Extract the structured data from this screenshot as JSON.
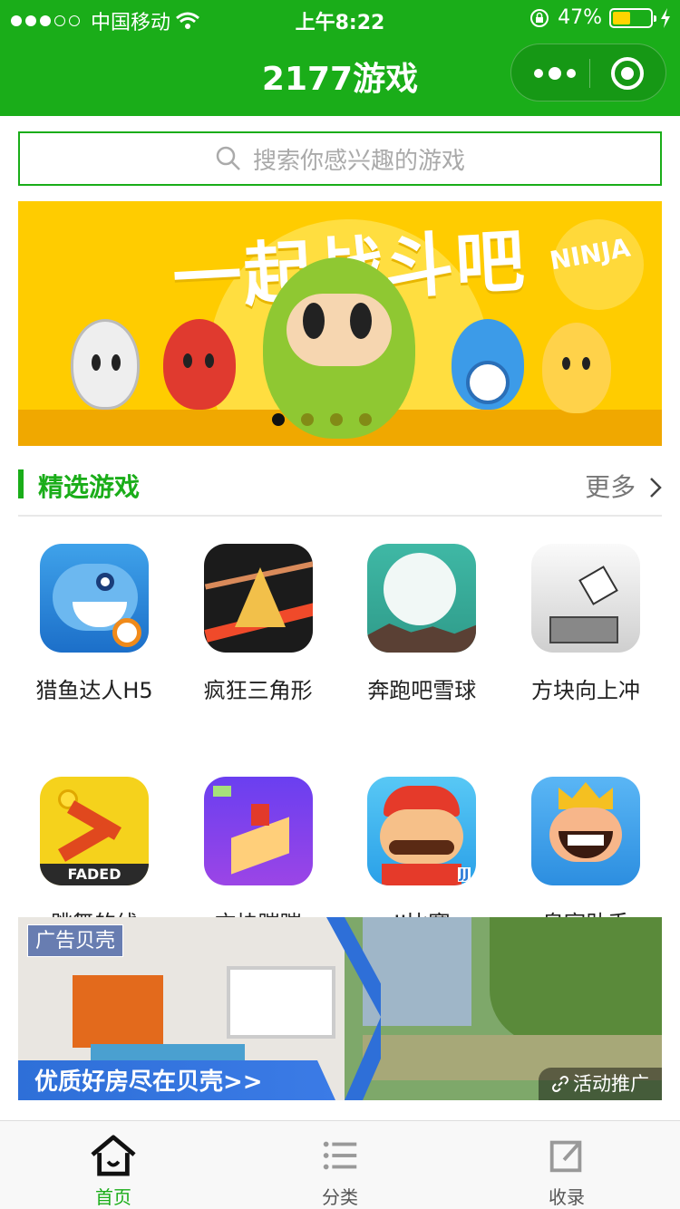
{
  "status_bar": {
    "carrier": "中国移动",
    "time": "上午8:22",
    "battery": "47%",
    "battery_level": 0.47
  },
  "nav": {
    "title": "2177游戏"
  },
  "search": {
    "placeholder": "搜索你感兴趣的游戏"
  },
  "banner": {
    "headline": "一起战斗吧",
    "badge": "NINJA",
    "page_index": 1,
    "page_count": 4
  },
  "section": {
    "title": "精选游戏",
    "more": "更多"
  },
  "games": [
    {
      "name": "猎鱼达人H5"
    },
    {
      "name": "疯狂三角形"
    },
    {
      "name": "奔跑吧雪球"
    },
    {
      "name": "方块向上冲"
    },
    {
      "name": "跳舞的线",
      "icon_text": "FADED"
    },
    {
      "name": "方块蹦蹦"
    },
    {
      "name": "JJ比赛",
      "icon_text": "JJ"
    },
    {
      "name": "皇室助手"
    }
  ],
  "ad": {
    "tag": "广告贝壳",
    "slogan": "优质好房尽在贝壳>>",
    "promo": "活动推广"
  },
  "tabbar": [
    {
      "label": "首页",
      "active": true
    },
    {
      "label": "分类",
      "active": false
    },
    {
      "label": "收录",
      "active": false
    }
  ],
  "colors": {
    "brand_green": "#1aad19",
    "banner_yellow": "#ffcc00"
  }
}
